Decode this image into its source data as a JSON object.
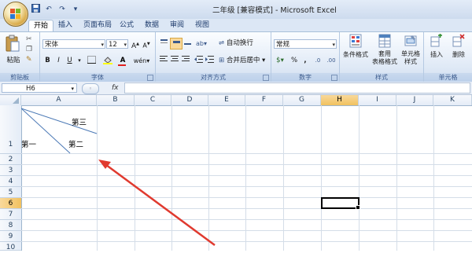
{
  "window": {
    "title": "二年级  [兼容模式] - Microsoft Excel"
  },
  "quick_access": {
    "undo": "↶",
    "redo": "↷",
    "customize": "▾"
  },
  "tabs": [
    "开始",
    "插入",
    "页面布局",
    "公式",
    "数据",
    "审阅",
    "视图"
  ],
  "ribbon": {
    "clipboard": {
      "label": "剪贴板",
      "paste": "粘贴"
    },
    "font": {
      "label": "字体",
      "font_name": "宋体",
      "font_size": "12",
      "grow": "A",
      "shrink": "A",
      "bold": "B",
      "italic": "I",
      "underline": "U",
      "phonetic": "wén"
    },
    "alignment": {
      "label": "对齐方式",
      "wrap": "自动换行",
      "merge": "合并后居中"
    },
    "number": {
      "label": "数字",
      "format": "常规",
      "percent": "%",
      "comma": ",",
      "inc_dec": ".0",
      "dec_dec": ".00"
    },
    "styles": {
      "label": "样式",
      "conditional": "条件格式",
      "table": "套用\n表格格式",
      "cell": "单元格\n样式"
    },
    "cells": {
      "label": "单元格",
      "insert": "插入",
      "delete": "删除"
    }
  },
  "formula_bar": {
    "name_box": "H6",
    "fx": "fx",
    "value": ""
  },
  "columns": [
    "A",
    "B",
    "C",
    "D",
    "E",
    "F",
    "G",
    "H",
    "I",
    "J",
    "K"
  ],
  "rows": [
    "1",
    "2",
    "3",
    "4",
    "5",
    "6",
    "7",
    "8",
    "9",
    "10"
  ],
  "selected": {
    "column": "H",
    "row": "6",
    "cell": "H6"
  },
  "cells": {
    "A1_top": "第三",
    "A1_mid": "第二",
    "A1_left": "第一"
  },
  "colors": {
    "accent": "#e03a2f",
    "header_sel": "#f1c15f",
    "ribbon_bg": "#dfe9f6"
  }
}
